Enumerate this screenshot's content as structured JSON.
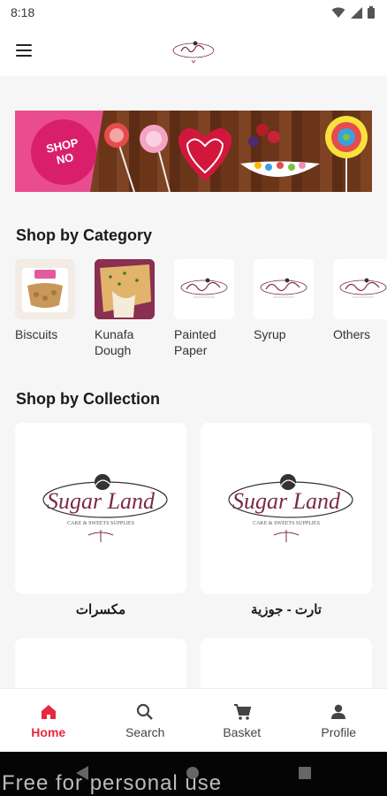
{
  "status_bar": {
    "time": "8:18"
  },
  "app_bar": {
    "logo_icon": "sugarland-logo-icon",
    "menu_icon": "hamburger-menu-icon"
  },
  "banner": {
    "line1": "SHOP",
    "line2": "NO"
  },
  "shop_by_category": {
    "title": "Shop by Category",
    "items": [
      {
        "label": "Biscuits"
      },
      {
        "label": "Kunafa Dough"
      },
      {
        "label": "Painted Paper"
      },
      {
        "label": "Syrup"
      },
      {
        "label": "Others"
      }
    ]
  },
  "shop_by_collection": {
    "title": "Shop by Collection",
    "items": [
      {
        "label": "مكسرات",
        "logo_script": "Sugar Land",
        "logo_tag": "CAKE & SWEETS SUPPLIES"
      },
      {
        "label": "تارت - جوزية",
        "logo_script": "Sugar Land",
        "logo_tag": "CAKE & SWEETS SUPPLIES"
      }
    ]
  },
  "bottom_nav": {
    "items": [
      {
        "label": "Home",
        "icon": "home-icon",
        "active": true
      },
      {
        "label": "Search",
        "icon": "search-icon",
        "active": false
      },
      {
        "label": "Basket",
        "icon": "cart-icon",
        "active": false
      },
      {
        "label": "Profile",
        "icon": "person-icon",
        "active": false
      }
    ]
  },
  "watermark": "Free for personal use",
  "colors": {
    "accent": "#e8283f",
    "brand": "#7b2a47",
    "banner_pink": "#ea4d8f"
  }
}
